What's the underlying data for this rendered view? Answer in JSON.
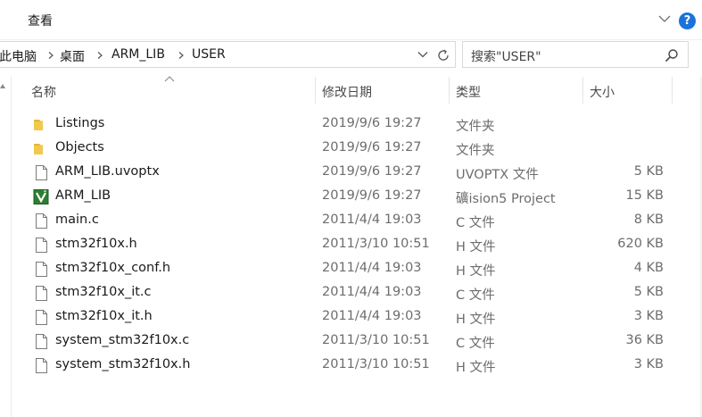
{
  "ribbon": {
    "tab_label": "查看"
  },
  "address": {
    "crumbs": [
      "此电脑",
      "桌面",
      "ARM_LIB",
      "USER"
    ]
  },
  "search": {
    "placeholder": "搜索\"USER\""
  },
  "columns": {
    "name": "名称",
    "date": "修改日期",
    "type": "类型",
    "size": "大小"
  },
  "files": [
    {
      "name": "Listings",
      "date": "2019/9/6 19:27",
      "type": "文件夹",
      "size": "",
      "icon": "folder-icon"
    },
    {
      "name": "Objects",
      "date": "2019/9/6 19:27",
      "type": "文件夹",
      "size": "",
      "icon": "folder-icon"
    },
    {
      "name": "ARM_LIB.uvoptx",
      "date": "2019/9/6 19:27",
      "type": "UVOPTX 文件",
      "size": "5 KB",
      "icon": "file-icon"
    },
    {
      "name": "ARM_LIB",
      "date": "2019/9/6 19:27",
      "type": "礦ision5 Project",
      "size": "15 KB",
      "icon": "keil-project-icon"
    },
    {
      "name": "main.c",
      "date": "2011/4/4 19:03",
      "type": "C 文件",
      "size": "8 KB",
      "icon": "file-icon"
    },
    {
      "name": "stm32f10x.h",
      "date": "2011/3/10 10:51",
      "type": "H 文件",
      "size": "620 KB",
      "icon": "file-icon"
    },
    {
      "name": "stm32f10x_conf.h",
      "date": "2011/4/4 19:03",
      "type": "H 文件",
      "size": "4 KB",
      "icon": "file-icon"
    },
    {
      "name": "stm32f10x_it.c",
      "date": "2011/4/4 19:03",
      "type": "C 文件",
      "size": "5 KB",
      "icon": "file-icon"
    },
    {
      "name": "stm32f10x_it.h",
      "date": "2011/4/4 19:03",
      "type": "H 文件",
      "size": "3 KB",
      "icon": "file-icon"
    },
    {
      "name": "system_stm32f10x.c",
      "date": "2011/3/10 10:51",
      "type": "C 文件",
      "size": "36 KB",
      "icon": "file-icon"
    },
    {
      "name": "system_stm32f10x.h",
      "date": "2011/3/10 10:51",
      "type": "H 文件",
      "size": "3 KB",
      "icon": "file-icon"
    }
  ],
  "colors": {
    "help_blue": "#1a73d9",
    "folder_yellow": "#f2c94c",
    "keil_green": "#2e7d32"
  }
}
